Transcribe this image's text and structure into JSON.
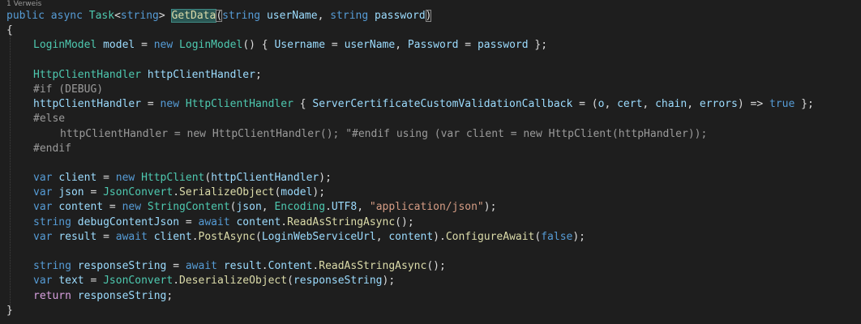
{
  "window": {
    "codelens": "1 Verweis"
  },
  "code": {
    "lines": [
      {
        "indent": 0,
        "tokens": [
          {
            "t": "public",
            "c": "kw"
          },
          {
            "t": " ",
            "c": "pun"
          },
          {
            "t": "async",
            "c": "kw"
          },
          {
            "t": " ",
            "c": "pun"
          },
          {
            "t": "Task",
            "c": "type"
          },
          {
            "t": "<",
            "c": "pun"
          },
          {
            "t": "string",
            "c": "kw"
          },
          {
            "t": "> ",
            "c": "pun"
          },
          {
            "t": "GetData",
            "c": "fn",
            "x": "hl"
          },
          {
            "t": "(",
            "c": "pun",
            "x": "brk"
          },
          {
            "t": "string",
            "c": "kw"
          },
          {
            "t": " ",
            "c": "pun"
          },
          {
            "t": "userName",
            "c": "var"
          },
          {
            "t": ", ",
            "c": "pun"
          },
          {
            "t": "string",
            "c": "kw"
          },
          {
            "t": " ",
            "c": "pun"
          },
          {
            "t": "password",
            "c": "var"
          },
          {
            "t": ")",
            "c": "pun",
            "x": "brk"
          }
        ]
      },
      {
        "indent": 0,
        "tokens": [
          {
            "t": "{",
            "c": "pun"
          }
        ]
      },
      {
        "indent": 1,
        "tokens": [
          {
            "t": "LoginModel",
            "c": "type"
          },
          {
            "t": " ",
            "c": "pun"
          },
          {
            "t": "model",
            "c": "var"
          },
          {
            "t": " = ",
            "c": "pun"
          },
          {
            "t": "new",
            "c": "kw"
          },
          {
            "t": " ",
            "c": "pun"
          },
          {
            "t": "LoginModel",
            "c": "type"
          },
          {
            "t": "() { ",
            "c": "pun"
          },
          {
            "t": "Username",
            "c": "var"
          },
          {
            "t": " = ",
            "c": "pun"
          },
          {
            "t": "userName",
            "c": "var"
          },
          {
            "t": ", ",
            "c": "pun"
          },
          {
            "t": "Password",
            "c": "var"
          },
          {
            "t": " = ",
            "c": "pun"
          },
          {
            "t": "password",
            "c": "var"
          },
          {
            "t": " };",
            "c": "pun"
          }
        ]
      },
      {
        "indent": 0,
        "tokens": []
      },
      {
        "indent": 1,
        "tokens": [
          {
            "t": "HttpClientHandler",
            "c": "type"
          },
          {
            "t": " ",
            "c": "pun"
          },
          {
            "t": "httpClientHandler",
            "c": "var"
          },
          {
            "t": ";",
            "c": "pun"
          }
        ]
      },
      {
        "indent": 1,
        "tokens": [
          {
            "t": "#if (DEBUG)",
            "c": "pre"
          }
        ]
      },
      {
        "indent": 1,
        "tokens": [
          {
            "t": "httpClientHandler",
            "c": "var"
          },
          {
            "t": " = ",
            "c": "pun"
          },
          {
            "t": "new",
            "c": "kw"
          },
          {
            "t": " ",
            "c": "pun"
          },
          {
            "t": "HttpClientHandler",
            "c": "type"
          },
          {
            "t": " { ",
            "c": "pun"
          },
          {
            "t": "ServerCertificateCustomValidationCallback",
            "c": "var"
          },
          {
            "t": " = (",
            "c": "pun"
          },
          {
            "t": "o",
            "c": "var"
          },
          {
            "t": ", ",
            "c": "pun"
          },
          {
            "t": "cert",
            "c": "var"
          },
          {
            "t": ", ",
            "c": "pun"
          },
          {
            "t": "chain",
            "c": "var"
          },
          {
            "t": ", ",
            "c": "pun"
          },
          {
            "t": "errors",
            "c": "var"
          },
          {
            "t": ") => ",
            "c": "pun"
          },
          {
            "t": "true",
            "c": "kw"
          },
          {
            "t": " };",
            "c": "pun"
          }
        ]
      },
      {
        "indent": 1,
        "tokens": [
          {
            "t": "#else",
            "c": "pre"
          }
        ]
      },
      {
        "indent": 2,
        "tokens": [
          {
            "t": "httpClientHandler = new HttpClientHandler(); \"#endif using (var client = new HttpClient(httpHandler));",
            "c": "dis"
          }
        ]
      },
      {
        "indent": 1,
        "tokens": [
          {
            "t": "#endif",
            "c": "pre"
          }
        ]
      },
      {
        "indent": 0,
        "tokens": []
      },
      {
        "indent": 1,
        "tokens": [
          {
            "t": "var",
            "c": "kw"
          },
          {
            "t": " ",
            "c": "pun"
          },
          {
            "t": "client",
            "c": "var"
          },
          {
            "t": " = ",
            "c": "pun"
          },
          {
            "t": "new",
            "c": "kw"
          },
          {
            "t": " ",
            "c": "pun"
          },
          {
            "t": "HttpClient",
            "c": "type"
          },
          {
            "t": "(",
            "c": "pun"
          },
          {
            "t": "httpClientHandler",
            "c": "var"
          },
          {
            "t": ");",
            "c": "pun"
          }
        ]
      },
      {
        "indent": 1,
        "tokens": [
          {
            "t": "var",
            "c": "kw"
          },
          {
            "t": " ",
            "c": "pun"
          },
          {
            "t": "json",
            "c": "var"
          },
          {
            "t": " = ",
            "c": "pun"
          },
          {
            "t": "JsonConvert",
            "c": "type"
          },
          {
            "t": ".",
            "c": "pun"
          },
          {
            "t": "SerializeObject",
            "c": "fn"
          },
          {
            "t": "(",
            "c": "pun"
          },
          {
            "t": "model",
            "c": "var"
          },
          {
            "t": ");",
            "c": "pun"
          }
        ]
      },
      {
        "indent": 1,
        "tokens": [
          {
            "t": "var",
            "c": "kw"
          },
          {
            "t": " ",
            "c": "pun"
          },
          {
            "t": "content",
            "c": "var"
          },
          {
            "t": " = ",
            "c": "pun"
          },
          {
            "t": "new",
            "c": "kw"
          },
          {
            "t": " ",
            "c": "pun"
          },
          {
            "t": "StringContent",
            "c": "type"
          },
          {
            "t": "(",
            "c": "pun"
          },
          {
            "t": "json",
            "c": "var"
          },
          {
            "t": ", ",
            "c": "pun"
          },
          {
            "t": "Encoding",
            "c": "type"
          },
          {
            "t": ".",
            "c": "pun"
          },
          {
            "t": "UTF8",
            "c": "var"
          },
          {
            "t": ", ",
            "c": "pun"
          },
          {
            "t": "\"application/json\"",
            "c": "str"
          },
          {
            "t": ");",
            "c": "pun"
          }
        ]
      },
      {
        "indent": 1,
        "tokens": [
          {
            "t": "string",
            "c": "kw"
          },
          {
            "t": " ",
            "c": "pun"
          },
          {
            "t": "debugContentJson",
            "c": "var"
          },
          {
            "t": " = ",
            "c": "pun"
          },
          {
            "t": "await",
            "c": "kw"
          },
          {
            "t": " ",
            "c": "pun"
          },
          {
            "t": "content",
            "c": "var"
          },
          {
            "t": ".",
            "c": "pun"
          },
          {
            "t": "ReadAsStringAsync",
            "c": "fn"
          },
          {
            "t": "();",
            "c": "pun"
          }
        ]
      },
      {
        "indent": 1,
        "tokens": [
          {
            "t": "var",
            "c": "kw"
          },
          {
            "t": " ",
            "c": "pun"
          },
          {
            "t": "result",
            "c": "var"
          },
          {
            "t": " = ",
            "c": "pun"
          },
          {
            "t": "await",
            "c": "kw"
          },
          {
            "t": " ",
            "c": "pun"
          },
          {
            "t": "client",
            "c": "var"
          },
          {
            "t": ".",
            "c": "pun"
          },
          {
            "t": "PostAsync",
            "c": "fn"
          },
          {
            "t": "(",
            "c": "pun"
          },
          {
            "t": "LoginWebServiceUrl",
            "c": "var"
          },
          {
            "t": ", ",
            "c": "pun"
          },
          {
            "t": "content",
            "c": "var"
          },
          {
            "t": ").",
            "c": "pun"
          },
          {
            "t": "ConfigureAwait",
            "c": "fn"
          },
          {
            "t": "(",
            "c": "pun"
          },
          {
            "t": "false",
            "c": "kw"
          },
          {
            "t": ");",
            "c": "pun"
          }
        ]
      },
      {
        "indent": 0,
        "tokens": []
      },
      {
        "indent": 1,
        "tokens": [
          {
            "t": "string",
            "c": "kw"
          },
          {
            "t": " ",
            "c": "pun"
          },
          {
            "t": "responseString",
            "c": "var"
          },
          {
            "t": " = ",
            "c": "pun"
          },
          {
            "t": "await",
            "c": "kw"
          },
          {
            "t": " ",
            "c": "pun"
          },
          {
            "t": "result",
            "c": "var"
          },
          {
            "t": ".",
            "c": "pun"
          },
          {
            "t": "Content",
            "c": "var"
          },
          {
            "t": ".",
            "c": "pun"
          },
          {
            "t": "ReadAsStringAsync",
            "c": "fn"
          },
          {
            "t": "();",
            "c": "pun"
          }
        ]
      },
      {
        "indent": 1,
        "tokens": [
          {
            "t": "var",
            "c": "kw"
          },
          {
            "t": " ",
            "c": "pun"
          },
          {
            "t": "text",
            "c": "var"
          },
          {
            "t": " = ",
            "c": "pun"
          },
          {
            "t": "JsonConvert",
            "c": "type"
          },
          {
            "t": ".",
            "c": "pun"
          },
          {
            "t": "DeserializeObject",
            "c": "fn"
          },
          {
            "t": "(",
            "c": "pun"
          },
          {
            "t": "responseString",
            "c": "var"
          },
          {
            "t": ");",
            "c": "pun"
          }
        ]
      },
      {
        "indent": 1,
        "tokens": [
          {
            "t": "return",
            "c": "ctrl"
          },
          {
            "t": " ",
            "c": "pun"
          },
          {
            "t": "responseString",
            "c": "var"
          },
          {
            "t": ";",
            "c": "pun"
          }
        ]
      },
      {
        "indent": 0,
        "tokens": [
          {
            "t": "}",
            "c": "pun"
          }
        ]
      }
    ]
  }
}
